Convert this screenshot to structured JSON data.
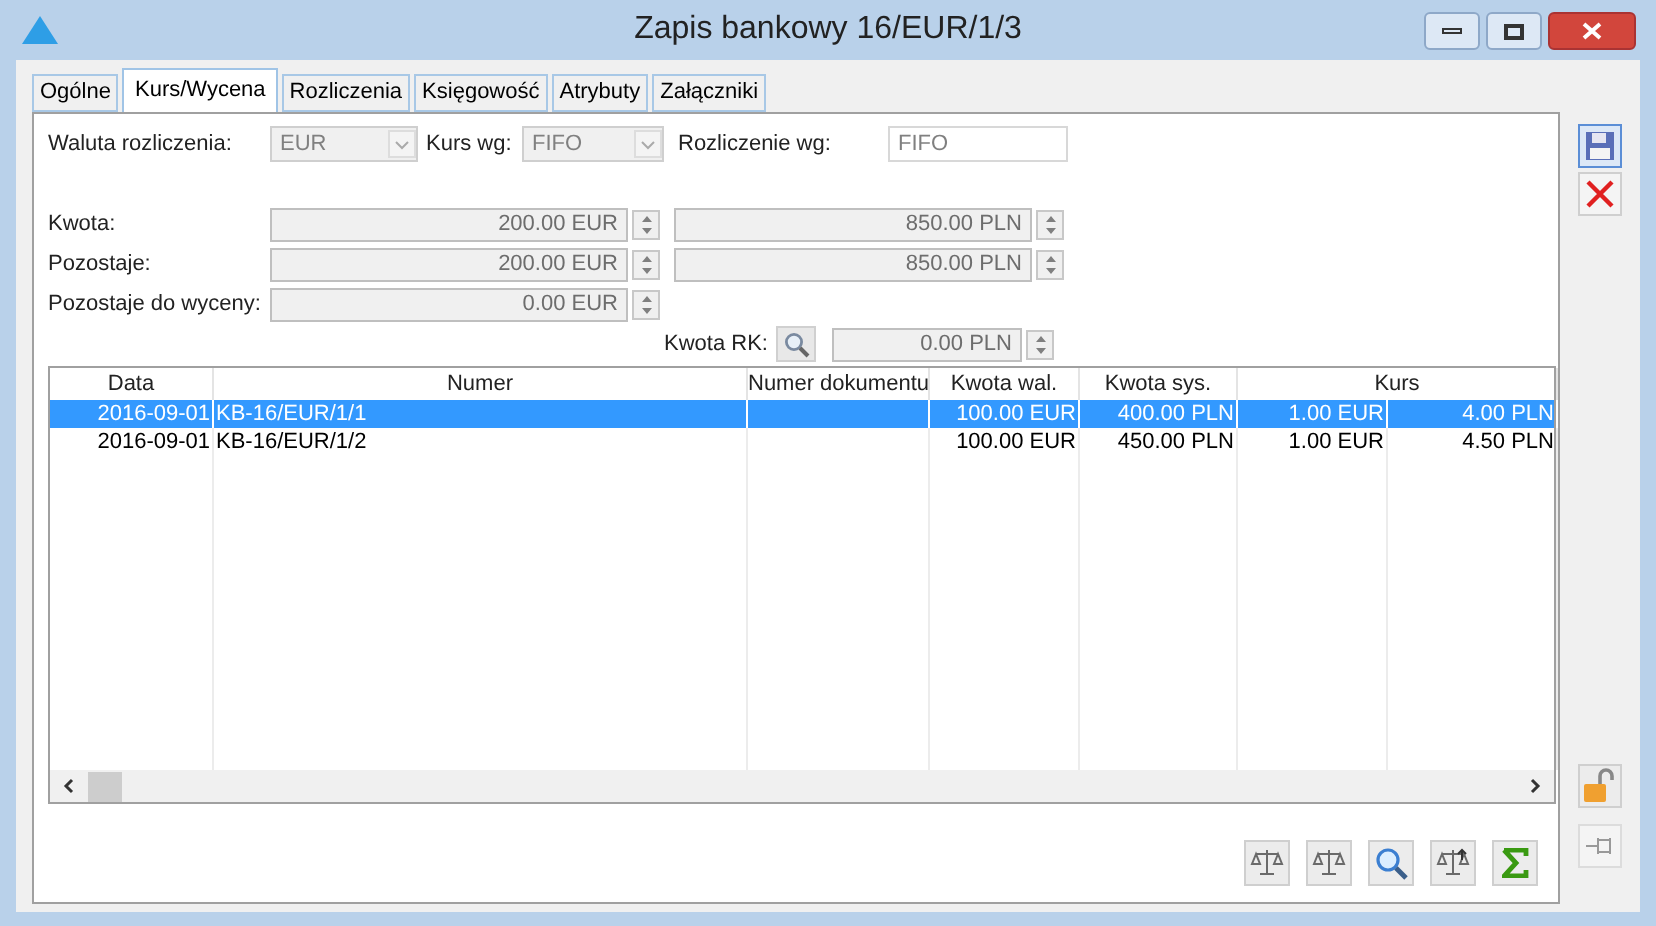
{
  "window": {
    "title": "Zapis bankowy 16/EUR/1/3"
  },
  "tabs": [
    {
      "label": "Ogólne",
      "selected": false
    },
    {
      "label": "Kurs/Wycena",
      "selected": true
    },
    {
      "label": "Rozliczenia",
      "selected": false
    },
    {
      "label": "Księgowość",
      "selected": false
    },
    {
      "label": "Atrybuty",
      "selected": false
    },
    {
      "label": "Załączniki",
      "selected": false
    }
  ],
  "settlement": {
    "currency_label": "Waluta rozliczenia:",
    "currency": "EUR",
    "rate_label": "Kurs wg:",
    "rate": "FIFO",
    "method_label": "Rozliczenie wg:",
    "method": "FIFO"
  },
  "amounts": [
    {
      "label": "Kwota:",
      "foreign": "200.00 EUR",
      "system": "850.00 PLN"
    },
    {
      "label": "Pozostaje:",
      "foreign": "200.00 EUR",
      "system": "850.00 PLN"
    },
    {
      "label": "Pozostaje do wyceny:",
      "foreign": "0.00 EUR"
    }
  ],
  "kwota_rk": {
    "label": "Kwota RK:",
    "value": "0.00 PLN"
  },
  "table": {
    "columns": [
      "Data",
      "Numer",
      "Numer dokumentu",
      "Kwota wal.",
      "Kwota sys.",
      "Kurs"
    ],
    "rows": [
      {
        "selected": true,
        "cells": [
          "2016-09-01",
          "KB-16/EUR/1/1",
          "",
          "100.00 EUR",
          "400.00 PLN",
          "1.00 EUR",
          "4.00 PLN"
        ]
      },
      {
        "selected": false,
        "cells": [
          "2016-09-01",
          "KB-16/EUR/1/2",
          "",
          "100.00 EUR",
          "450.00 PLN",
          "1.00 EUR",
          "4.50 PLN"
        ]
      }
    ]
  }
}
